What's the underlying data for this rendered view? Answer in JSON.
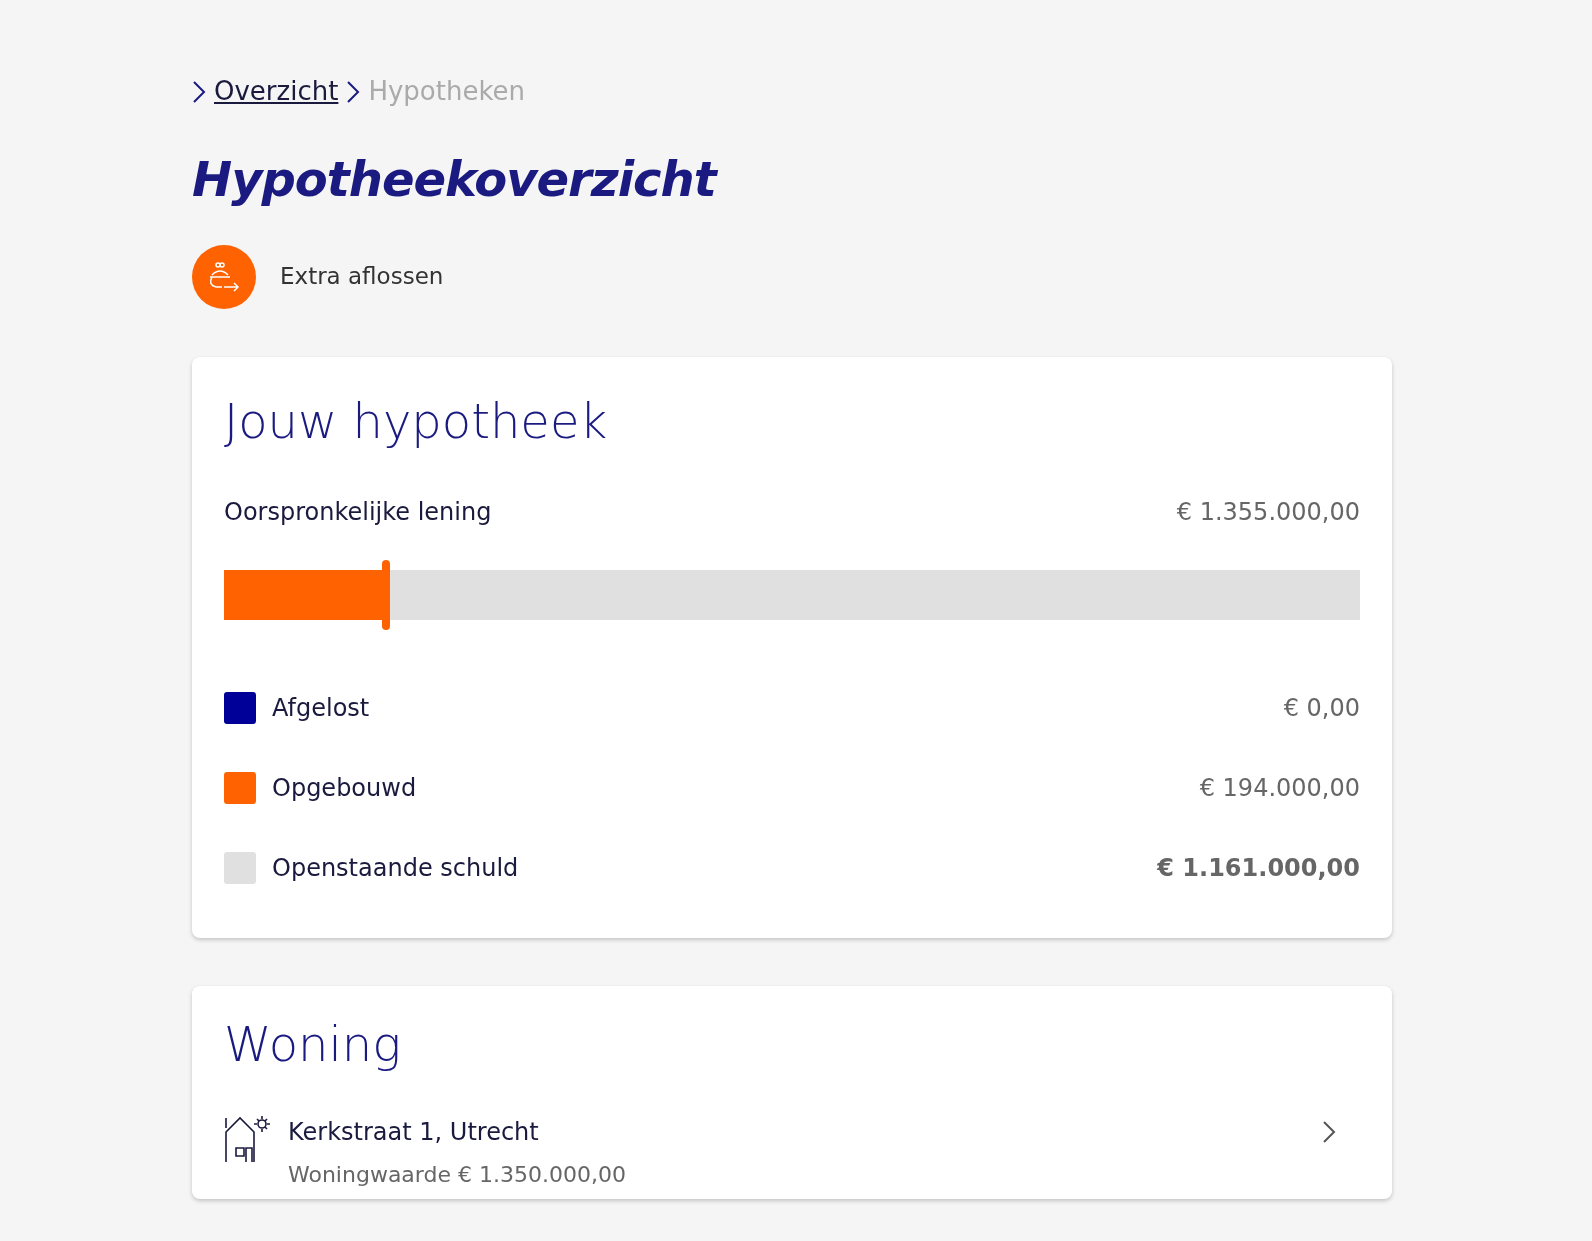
{
  "breadcrumb": [
    {
      "label": "Overzicht",
      "kind": "link"
    },
    {
      "label": "Hypotheken",
      "kind": "current"
    }
  ],
  "title": "Hypotheekoverzicht",
  "actions": [
    {
      "label": "Extra aflossen"
    }
  ],
  "mortgage": {
    "title": "Jouw hypotheek",
    "original_label": "Oorspronkelijke lening",
    "original_amount": "€ 1.355.000,00",
    "progress": {
      "level": 0.143
    },
    "legend": [
      {
        "label": "Afgelost",
        "amount": "€ 0,00",
        "color": "#000099",
        "emphasis": false
      },
      {
        "label": "Opgebouwd",
        "amount": "€ 194.000,00",
        "color": "#ff6200",
        "emphasis": false
      },
      {
        "label": "Openstaande schuld",
        "amount": "€ 1.161.000,00",
        "color": "#e0e0e0",
        "emphasis": true
      }
    ]
  },
  "home": {
    "title": "Woning",
    "properties": [
      {
        "address": "Kerkstraat 1, Utrecht",
        "value": "Woningwaarde € 1.350.000,00"
      }
    ]
  }
}
